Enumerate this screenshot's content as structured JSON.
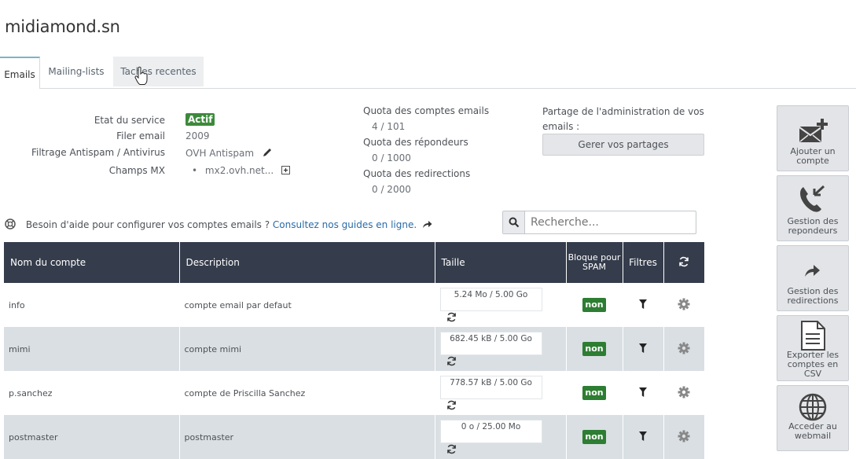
{
  "page": {
    "title": "midiamond.sn"
  },
  "tabs": [
    {
      "label": "Emails"
    },
    {
      "label": "Mailing-lists"
    },
    {
      "label": "Taches recentes"
    }
  ],
  "service": {
    "etat_label": "Etat du service",
    "etat_value": "Actif",
    "filer_label": "Filer email",
    "filer_value": "2009",
    "filtrage_label": "Filtrage Antispam / Antivirus",
    "filtrage_value": "OVH Antispam",
    "mx_label": "Champs MX",
    "mx_value": "mx2.ovh.net..."
  },
  "quotas": {
    "comptes_label": "Quota des comptes emails",
    "comptes_value": "4 / 101",
    "repondeurs_label": "Quota des répondeurs",
    "repondeurs_value": "0 / 1000",
    "redirections_label": "Quota des redirections",
    "redirections_value": "0 / 2000"
  },
  "share": {
    "text": "Partage de l'administration de vos emails :",
    "button": "Gerer vos partages"
  },
  "help": {
    "text": "Besoin d'aide pour configurer vos comptes emails ?",
    "link": "Consultez nos guides en ligne."
  },
  "search": {
    "placeholder": "Recherche..."
  },
  "table": {
    "headers": {
      "name": "Nom du compte",
      "description": "Description",
      "size": "Taille",
      "bloque": "Bloque pour SPAM",
      "filtres": "Filtres"
    },
    "rows": [
      {
        "name": "info",
        "description": "compte email par defaut",
        "size": "5.24 Mo / 5.00 Go",
        "spam": "non"
      },
      {
        "name": "mimi",
        "description": "compte mimi",
        "size": "682.45 kB / 5.00 Go",
        "spam": "non"
      },
      {
        "name": "p.sanchez",
        "description": "compte de Priscilla Sanchez",
        "size": "778.57 kB / 5.00 Go",
        "spam": "non"
      },
      {
        "name": "postmaster",
        "description": "postmaster",
        "size": "0 o / 25.00 Mo",
        "spam": "non"
      }
    ]
  },
  "sidebar": [
    {
      "label": "Ajouter un compte",
      "icon": "envelope-plus-icon"
    },
    {
      "label": "Gestion des repondeurs",
      "icon": "phone-callback-icon"
    },
    {
      "label": "Gestion des redirections",
      "icon": "redirect-arrow-icon"
    },
    {
      "label": "Exporter les comptes en CSV",
      "icon": "document-icon"
    },
    {
      "label": "Acceder au webmail",
      "icon": "globe-icon"
    }
  ],
  "colors": {
    "header_bg": "#353c4b",
    "badge_green": "#2d7d32",
    "link": "#2a6aa8",
    "row_alt": "#d9dfe3"
  }
}
